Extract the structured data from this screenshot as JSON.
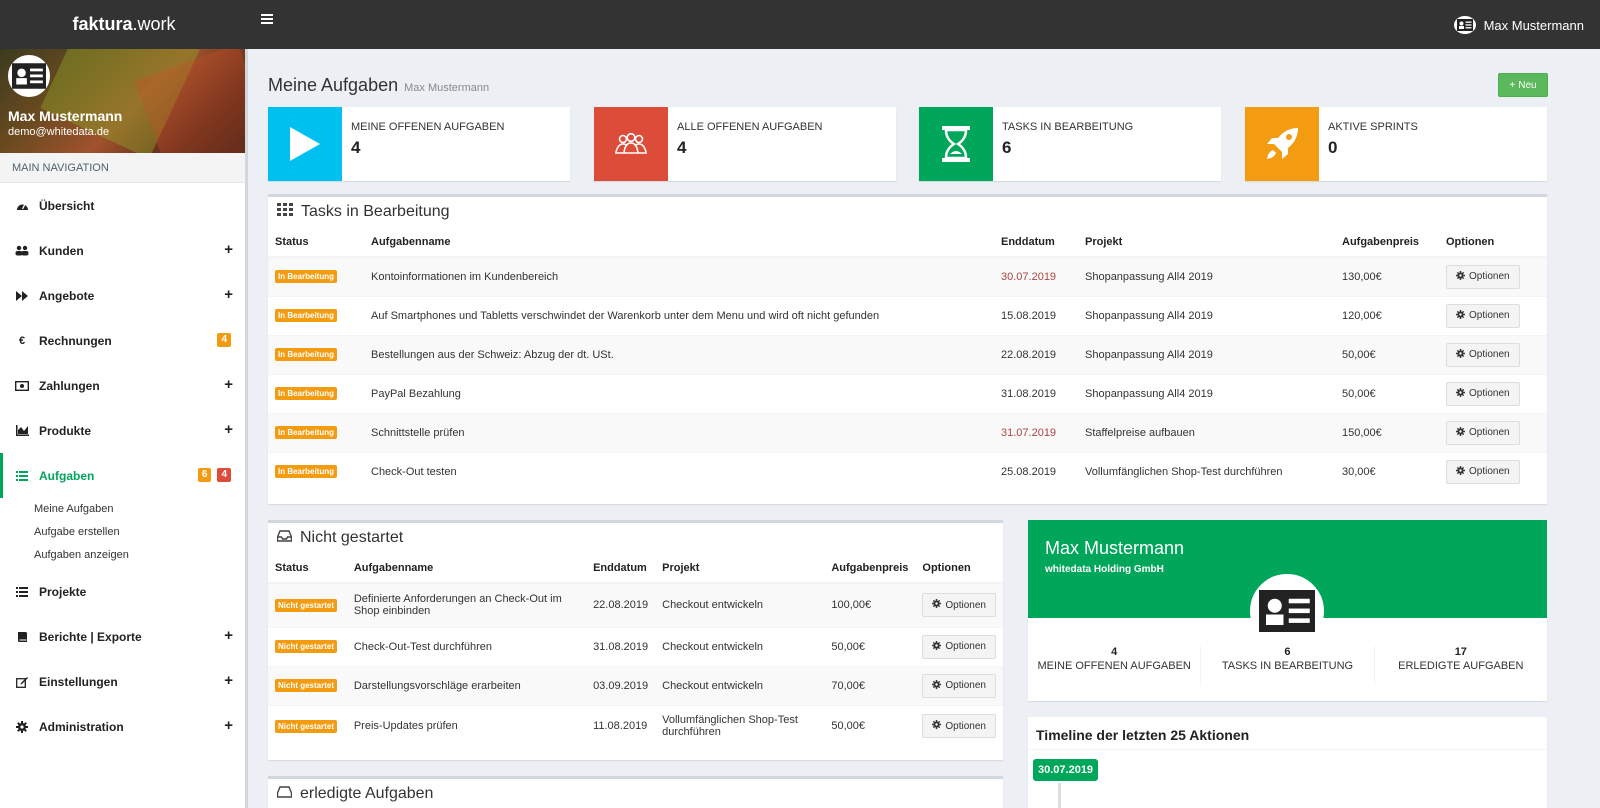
{
  "app": {
    "logo_strong": "faktura",
    "logo_rest": ".work"
  },
  "topbar": {
    "user": "Max Mustermann"
  },
  "sidebar": {
    "user_name": "Max Mustermann",
    "user_email": "demo@whitedata.de",
    "nav_header": "MAIN NAVIGATION",
    "items": [
      {
        "label": "Übersicht",
        "icon": "dashboard-icon"
      },
      {
        "label": "Kunden",
        "icon": "users-icon"
      },
      {
        "label": "Angebote",
        "icon": "forward-icon"
      },
      {
        "label": "Rechnungen",
        "icon": "euro-icon",
        "badge": "4"
      },
      {
        "label": "Zahlungen",
        "icon": "money-icon"
      },
      {
        "label": "Produkte",
        "icon": "bar-chart-icon"
      },
      {
        "label": "Aufgaben",
        "icon": "list-icon",
        "badge1": "6",
        "badge2": "4"
      },
      {
        "label": "Projekte",
        "icon": "list-icon"
      },
      {
        "label": "Berichte | Exporte",
        "icon": "book-icon"
      },
      {
        "label": "Einstellungen",
        "icon": "edit-icon"
      },
      {
        "label": "Administration",
        "icon": "gear-icon"
      }
    ],
    "sub_items": [
      "Meine Aufgaben",
      "Aufgabe erstellen",
      "Aufgaben anzeigen"
    ]
  },
  "page": {
    "title": "Meine Aufgaben",
    "subtitle": "Max Mustermann",
    "new_button": "Neu"
  },
  "infoboxes": [
    {
      "label": "MEINE OFFENEN AUFGABEN",
      "value": "4",
      "color": "#00c0ef",
      "icon": "play-icon"
    },
    {
      "label": "ALLE OFFENEN AUFGABEN",
      "value": "4",
      "color": "#dd4b39",
      "icon": "group-icon"
    },
    {
      "label": "TASKS IN BEARBEITUNG",
      "value": "6",
      "color": "#00a65a",
      "icon": "hourglass-icon"
    },
    {
      "label": "AKTIVE SPRINTS",
      "value": "0",
      "color": "#f39c12",
      "icon": "rocket-icon"
    }
  ],
  "tasks_box": {
    "title": "Tasks in Bearbeitung",
    "headers": [
      "Status",
      "Aufgabenname",
      "Enddatum",
      "Projekt",
      "Aufgabenpreis",
      "Optionen"
    ],
    "status_label": "In Bearbeitung",
    "option_label": "Optionen",
    "rows": [
      {
        "name": "Kontoinformationen im Kundenbereich",
        "date": "30.07.2019",
        "overdue": true,
        "project": "Shopanpassung All4 2019",
        "price": "130,00€"
      },
      {
        "name": "Auf Smartphones und Tabletts verschwindet der Warenkorb unter dem Menu und wird oft nicht gefunden",
        "date": "15.08.2019",
        "overdue": false,
        "project": "Shopanpassung All4 2019",
        "price": "120,00€"
      },
      {
        "name": "Bestellungen aus der Schweiz: Abzug der dt. USt.",
        "date": "22.08.2019",
        "overdue": false,
        "project": "Shopanpassung All4 2019",
        "price": "50,00€"
      },
      {
        "name": "PayPal Bezahlung",
        "date": "31.08.2019",
        "overdue": false,
        "project": "Shopanpassung All4 2019",
        "price": "50,00€"
      },
      {
        "name": "Schnittstelle prüfen",
        "date": "31.07.2019",
        "overdue": true,
        "project": "Staffelpreise aufbauen",
        "price": "150,00€"
      },
      {
        "name": "Check-Out testen",
        "date": "25.08.2019",
        "overdue": false,
        "project": "Vollumfänglichen Shop-Test durchführen",
        "price": "30,00€"
      }
    ]
  },
  "notstarted_box": {
    "title": "Nicht gestartet",
    "headers": [
      "Status",
      "Aufgabenname",
      "Enddatum",
      "Projekt",
      "Aufgabenpreis",
      "Optionen"
    ],
    "status_label": "Nicht gestartet",
    "option_label": "Optionen",
    "rows": [
      {
        "name": "Definierte Anforderungen an Check-Out im Shop einbinden",
        "date": "22.08.2019",
        "project": "Checkout entwickeln",
        "price": "100,00€"
      },
      {
        "name": "Check-Out-Test durchführen",
        "date": "31.08.2019",
        "project": "Checkout entwickeln",
        "price": "50,00€"
      },
      {
        "name": "Darstellungsvorschläge erarbeiten",
        "date": "03.09.2019",
        "project": "Checkout entwickeln",
        "price": "70,00€"
      },
      {
        "name": "Preis-Updates prüfen",
        "date": "11.08.2019",
        "project": "Vollumfänglichen Shop-Test durchführen",
        "price": "50,00€"
      }
    ]
  },
  "done_box": {
    "title": "erledigte Aufgaben"
  },
  "profile": {
    "name": "Max Mustermann",
    "company": "whitedata Holding GmbH",
    "stats": [
      {
        "value": "4",
        "label": "MEINE OFFENEN AUFGABEN"
      },
      {
        "value": "6",
        "label": "TASKS IN BEARBEITUNG"
      },
      {
        "value": "17",
        "label": "ERLEDIGTE AUFGABEN"
      }
    ]
  },
  "timeline": {
    "title": "Timeline der letzten 25 Aktionen",
    "first_date": "30.07.2019"
  }
}
